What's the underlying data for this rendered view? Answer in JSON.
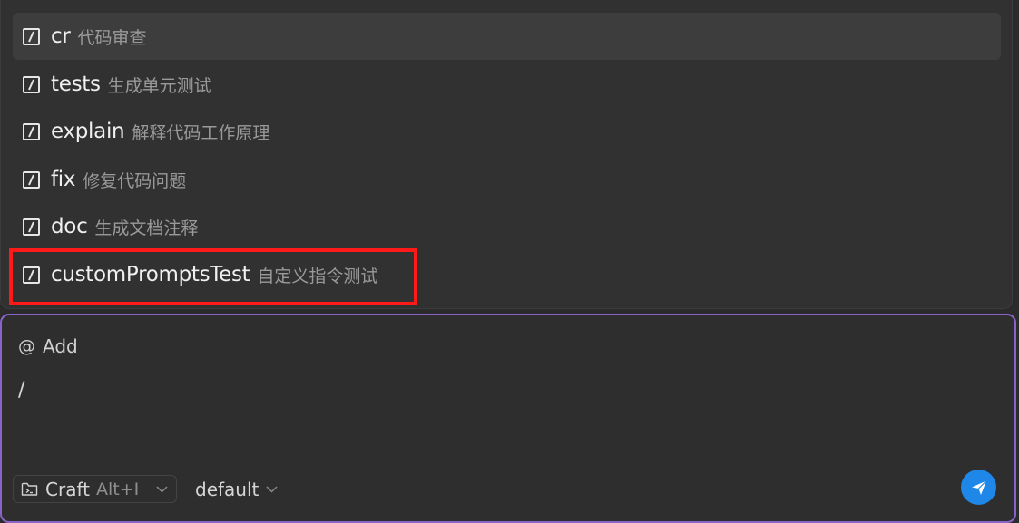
{
  "commands": [
    {
      "name": "cr",
      "desc": "代码审查"
    },
    {
      "name": "tests",
      "desc": "生成单元测试"
    },
    {
      "name": "explain",
      "desc": "解释代码工作原理"
    },
    {
      "name": "fix",
      "desc": "修复代码问题"
    },
    {
      "name": "doc",
      "desc": "生成文档注释"
    },
    {
      "name": "customPromptsTest",
      "desc": "自定义指令测试"
    }
  ],
  "composer": {
    "add_symbol": "@",
    "add_label": "Add",
    "input_value": "/",
    "mode_label": "Craft",
    "mode_shortcut": "Alt+I",
    "model_label": "default"
  },
  "colors": {
    "highlight": "#ff1a1a",
    "focus_border": "#8a63c9",
    "send_button": "#1f87e8"
  },
  "icons": {
    "command": "slash-square-icon",
    "mode": "terminal-folder-icon",
    "dropdown": "chevron-down-icon",
    "send": "paper-plane-icon"
  }
}
